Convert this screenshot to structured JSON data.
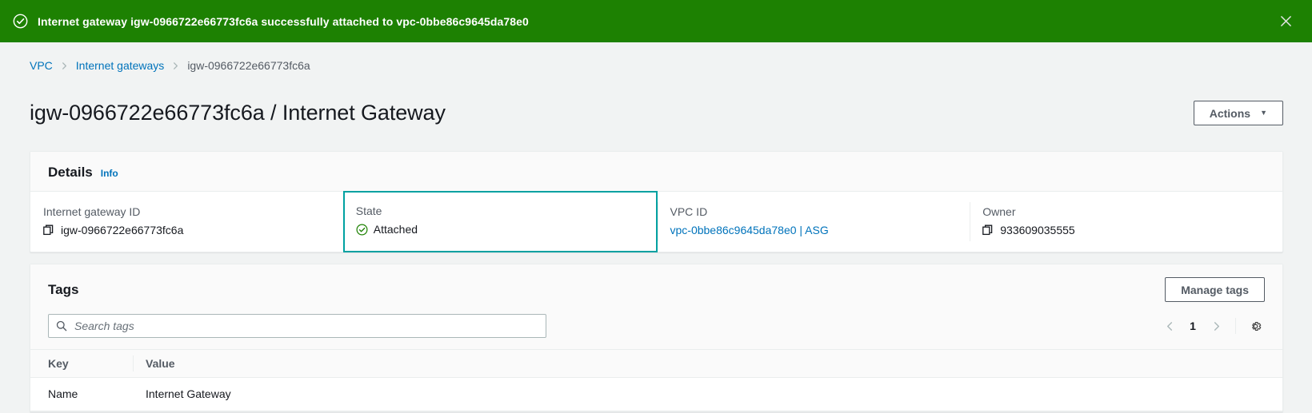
{
  "flash": {
    "message": "Internet gateway igw-0966722e66773fc6a successfully attached to vpc-0bbe86c9645da78e0",
    "success_icon": "check-circle-icon",
    "close_icon": "close-icon",
    "background_color": "#1d8102",
    "text_color": "#ffffff"
  },
  "breadcrumb": {
    "items": [
      {
        "label": "VPC",
        "link": true
      },
      {
        "label": "Internet gateways",
        "link": true
      },
      {
        "label": "igw-0966722e66773fc6a",
        "link": false
      }
    ],
    "separator_icon": "chevron-right-icon",
    "link_color": "#0073bb"
  },
  "header": {
    "title": "igw-0966722e66773fc6a / Internet Gateway",
    "actions_label": "Actions",
    "actions_caret": "▼"
  },
  "details": {
    "title": "Details",
    "info_label": "Info",
    "fields": [
      {
        "label": "Internet gateway ID",
        "value": "igw-0966722e66773fc6a",
        "icon": "copy-icon",
        "type": "copyable",
        "highlight": false
      },
      {
        "label": "State",
        "value": "Attached",
        "icon": "check-circle-icon",
        "type": "status",
        "highlight": true,
        "status_color": "#1d8102",
        "highlight_color": "#00a1a1"
      },
      {
        "label": "VPC ID",
        "value": "vpc-0bbe86c9645da78e0 | ASG",
        "type": "link",
        "highlight": false,
        "link_color": "#0073bb"
      },
      {
        "label": "Owner",
        "value": "933609035555",
        "icon": "copy-icon",
        "type": "copyable",
        "highlight": false
      }
    ]
  },
  "tags": {
    "title": "Tags",
    "manage_label": "Manage tags",
    "search": {
      "placeholder": "Search tags",
      "value": "",
      "icon": "search-icon"
    },
    "pagination": {
      "prev_icon": "chevron-left-icon",
      "next_icon": "chevron-right-icon",
      "current_page": "1",
      "settings_icon": "gear-icon"
    },
    "columns": [
      "Key",
      "Value"
    ],
    "rows": [
      {
        "key": "Name",
        "value": "Internet Gateway"
      }
    ]
  }
}
